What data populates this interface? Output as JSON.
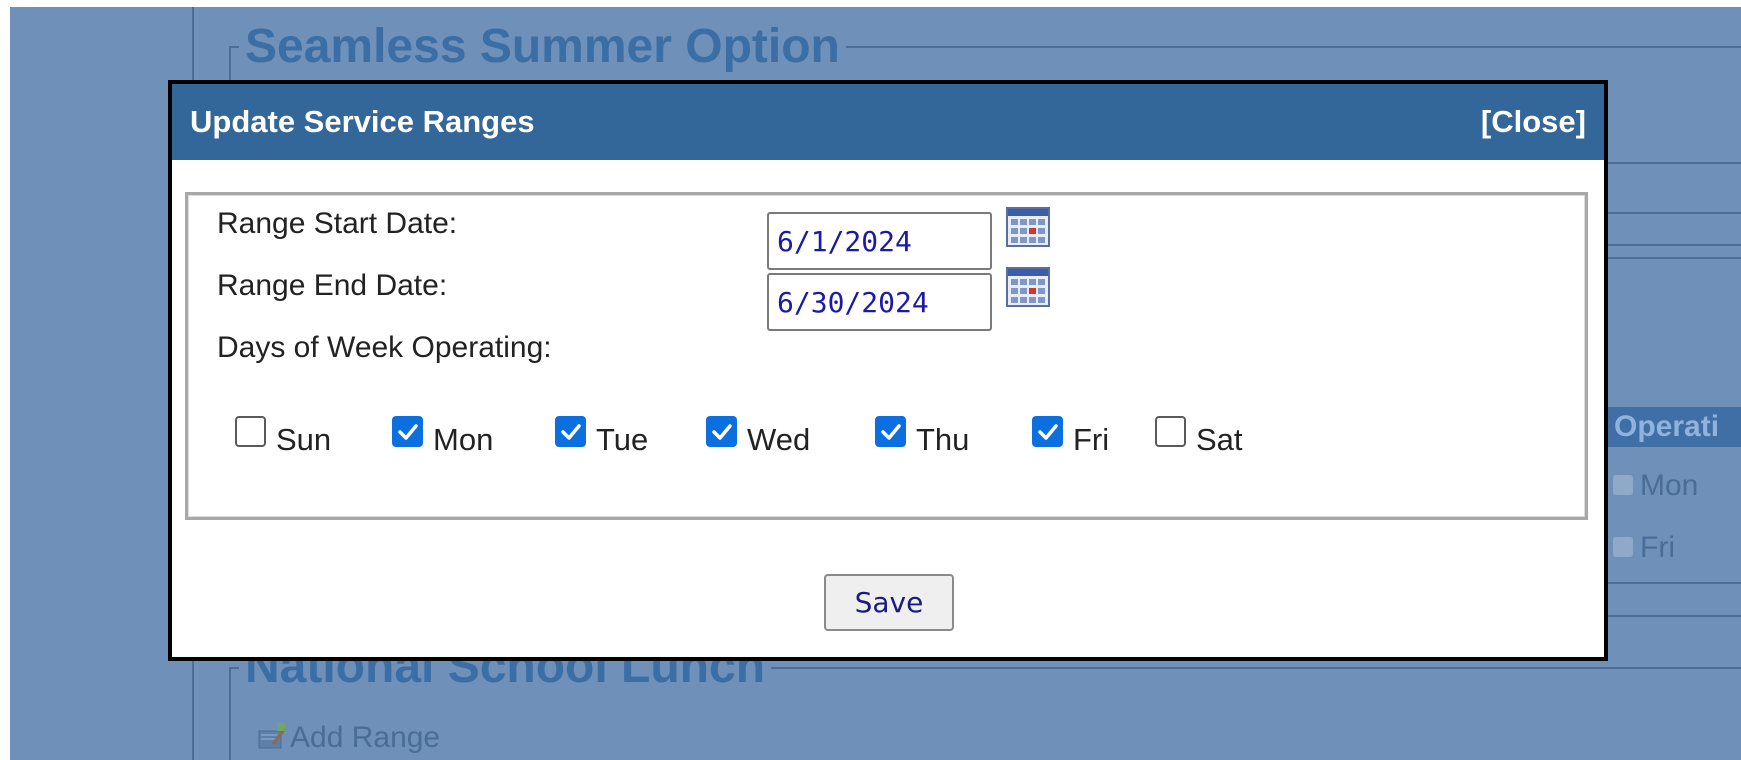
{
  "background": {
    "section_seamless_title": "Seamless Summer Option",
    "section_nsl_title": "National School Lunch",
    "operating_label": "Operati",
    "day_mon": "Mon",
    "day_fri": "Fri",
    "add_range_label": "Add Range"
  },
  "modal": {
    "title": "Update Service Ranges",
    "close_label": "[Close]",
    "range_start_label": "Range Start Date:",
    "range_start_value": "6/1/2024",
    "range_end_label": "Range End Date:",
    "range_end_value": "6/30/2024",
    "days_label": "Days of Week Operating:",
    "days": [
      {
        "label": "Sun",
        "checked": false
      },
      {
        "label": "Mon",
        "checked": true
      },
      {
        "label": "Tue",
        "checked": true
      },
      {
        "label": "Wed",
        "checked": true
      },
      {
        "label": "Thu",
        "checked": true
      },
      {
        "label": "Fri",
        "checked": true
      },
      {
        "label": "Sat",
        "checked": false
      }
    ],
    "save_label": "Save"
  },
  "icons": {
    "calendar": "calendar-icon",
    "checkmark": "checkmark-icon",
    "add_range": "add-range-icon"
  },
  "colors": {
    "header": "#336699",
    "overlay": "#6f90b8",
    "checkbox_checked": "#0b6fe0"
  }
}
